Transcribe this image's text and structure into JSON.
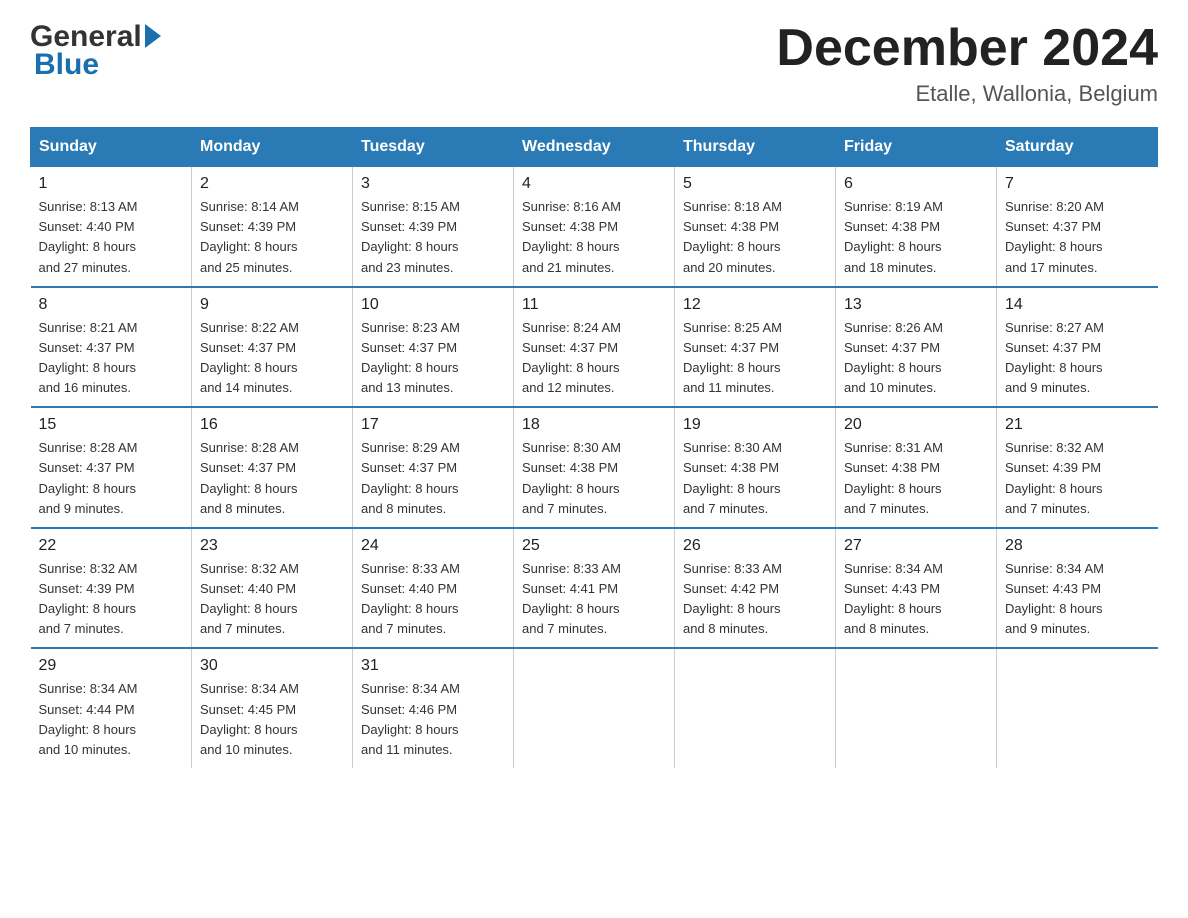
{
  "logo": {
    "general": "General",
    "blue": "Blue"
  },
  "header": {
    "title": "December 2024",
    "subtitle": "Etalle, Wallonia, Belgium"
  },
  "weekdays": [
    "Sunday",
    "Monday",
    "Tuesday",
    "Wednesday",
    "Thursday",
    "Friday",
    "Saturday"
  ],
  "weeks": [
    [
      {
        "day": "1",
        "info": "Sunrise: 8:13 AM\nSunset: 4:40 PM\nDaylight: 8 hours\nand 27 minutes."
      },
      {
        "day": "2",
        "info": "Sunrise: 8:14 AM\nSunset: 4:39 PM\nDaylight: 8 hours\nand 25 minutes."
      },
      {
        "day": "3",
        "info": "Sunrise: 8:15 AM\nSunset: 4:39 PM\nDaylight: 8 hours\nand 23 minutes."
      },
      {
        "day": "4",
        "info": "Sunrise: 8:16 AM\nSunset: 4:38 PM\nDaylight: 8 hours\nand 21 minutes."
      },
      {
        "day": "5",
        "info": "Sunrise: 8:18 AM\nSunset: 4:38 PM\nDaylight: 8 hours\nand 20 minutes."
      },
      {
        "day": "6",
        "info": "Sunrise: 8:19 AM\nSunset: 4:38 PM\nDaylight: 8 hours\nand 18 minutes."
      },
      {
        "day": "7",
        "info": "Sunrise: 8:20 AM\nSunset: 4:37 PM\nDaylight: 8 hours\nand 17 minutes."
      }
    ],
    [
      {
        "day": "8",
        "info": "Sunrise: 8:21 AM\nSunset: 4:37 PM\nDaylight: 8 hours\nand 16 minutes."
      },
      {
        "day": "9",
        "info": "Sunrise: 8:22 AM\nSunset: 4:37 PM\nDaylight: 8 hours\nand 14 minutes."
      },
      {
        "day": "10",
        "info": "Sunrise: 8:23 AM\nSunset: 4:37 PM\nDaylight: 8 hours\nand 13 minutes."
      },
      {
        "day": "11",
        "info": "Sunrise: 8:24 AM\nSunset: 4:37 PM\nDaylight: 8 hours\nand 12 minutes."
      },
      {
        "day": "12",
        "info": "Sunrise: 8:25 AM\nSunset: 4:37 PM\nDaylight: 8 hours\nand 11 minutes."
      },
      {
        "day": "13",
        "info": "Sunrise: 8:26 AM\nSunset: 4:37 PM\nDaylight: 8 hours\nand 10 minutes."
      },
      {
        "day": "14",
        "info": "Sunrise: 8:27 AM\nSunset: 4:37 PM\nDaylight: 8 hours\nand 9 minutes."
      }
    ],
    [
      {
        "day": "15",
        "info": "Sunrise: 8:28 AM\nSunset: 4:37 PM\nDaylight: 8 hours\nand 9 minutes."
      },
      {
        "day": "16",
        "info": "Sunrise: 8:28 AM\nSunset: 4:37 PM\nDaylight: 8 hours\nand 8 minutes."
      },
      {
        "day": "17",
        "info": "Sunrise: 8:29 AM\nSunset: 4:37 PM\nDaylight: 8 hours\nand 8 minutes."
      },
      {
        "day": "18",
        "info": "Sunrise: 8:30 AM\nSunset: 4:38 PM\nDaylight: 8 hours\nand 7 minutes."
      },
      {
        "day": "19",
        "info": "Sunrise: 8:30 AM\nSunset: 4:38 PM\nDaylight: 8 hours\nand 7 minutes."
      },
      {
        "day": "20",
        "info": "Sunrise: 8:31 AM\nSunset: 4:38 PM\nDaylight: 8 hours\nand 7 minutes."
      },
      {
        "day": "21",
        "info": "Sunrise: 8:32 AM\nSunset: 4:39 PM\nDaylight: 8 hours\nand 7 minutes."
      }
    ],
    [
      {
        "day": "22",
        "info": "Sunrise: 8:32 AM\nSunset: 4:39 PM\nDaylight: 8 hours\nand 7 minutes."
      },
      {
        "day": "23",
        "info": "Sunrise: 8:32 AM\nSunset: 4:40 PM\nDaylight: 8 hours\nand 7 minutes."
      },
      {
        "day": "24",
        "info": "Sunrise: 8:33 AM\nSunset: 4:40 PM\nDaylight: 8 hours\nand 7 minutes."
      },
      {
        "day": "25",
        "info": "Sunrise: 8:33 AM\nSunset: 4:41 PM\nDaylight: 8 hours\nand 7 minutes."
      },
      {
        "day": "26",
        "info": "Sunrise: 8:33 AM\nSunset: 4:42 PM\nDaylight: 8 hours\nand 8 minutes."
      },
      {
        "day": "27",
        "info": "Sunrise: 8:34 AM\nSunset: 4:43 PM\nDaylight: 8 hours\nand 8 minutes."
      },
      {
        "day": "28",
        "info": "Sunrise: 8:34 AM\nSunset: 4:43 PM\nDaylight: 8 hours\nand 9 minutes."
      }
    ],
    [
      {
        "day": "29",
        "info": "Sunrise: 8:34 AM\nSunset: 4:44 PM\nDaylight: 8 hours\nand 10 minutes."
      },
      {
        "day": "30",
        "info": "Sunrise: 8:34 AM\nSunset: 4:45 PM\nDaylight: 8 hours\nand 10 minutes."
      },
      {
        "day": "31",
        "info": "Sunrise: 8:34 AM\nSunset: 4:46 PM\nDaylight: 8 hours\nand 11 minutes."
      },
      null,
      null,
      null,
      null
    ]
  ]
}
